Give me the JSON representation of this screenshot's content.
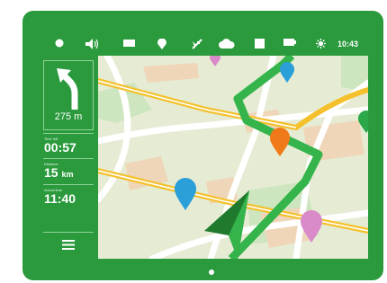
{
  "statusbar": {
    "time": "10:43",
    "icons": [
      "record-icon",
      "volume-icon",
      "message-icon",
      "location-icon",
      "satellite-icon",
      "cloud-icon",
      "stop-icon",
      "battery-icon",
      "brightness-icon"
    ]
  },
  "navigation": {
    "turn_distance": "275 m",
    "time_left": {
      "label": "Time left",
      "value": "00:57"
    },
    "distance": {
      "label": "Distance",
      "value": "15",
      "unit": "km"
    },
    "arrival": {
      "label": "Arrival time",
      "value": "11:40"
    }
  },
  "map": {
    "pins": [
      {
        "name": "blue-pin-small",
        "color": "#2b9fd8"
      },
      {
        "name": "pink-pin-small",
        "color": "#d98ac8"
      },
      {
        "name": "orange-pin",
        "color": "#f07a1a"
      },
      {
        "name": "green-pin",
        "color": "#2aa84a"
      },
      {
        "name": "blue-pin-large",
        "color": "#2b9fd8"
      },
      {
        "name": "pink-pin-large",
        "color": "#d98ac8"
      }
    ]
  },
  "colors": {
    "device": "#2a9a3c",
    "route": "#34b44a",
    "road_yellow": "#f4c12c",
    "block": "#efd6b9",
    "park": "#cde6bf"
  }
}
